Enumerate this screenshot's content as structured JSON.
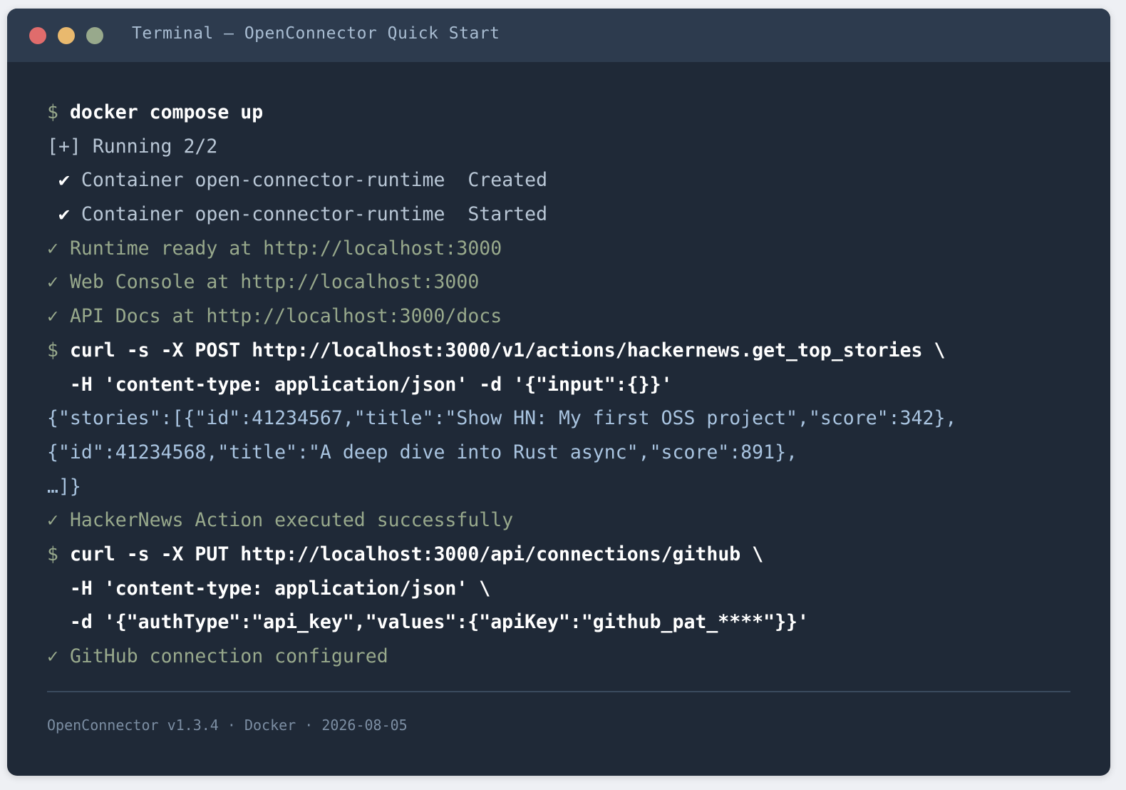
{
  "window": {
    "title": "Terminal — OpenConnector Quick Start",
    "controls": [
      "close",
      "minimize",
      "maximize"
    ]
  },
  "terminal": {
    "prompt_symbol": "$",
    "check_symbol": "✓",
    "check_bold_symbol": "✔",
    "lines": {
      "l1_cmd": "docker compose up",
      "l2_out": "[+] Running 2/2",
      "l3_out": "Container open-connector-runtime  Created",
      "l4_out": "Container open-connector-runtime  Started",
      "l5_ok": "Runtime ready at http://localhost:3000",
      "l6_ok": "Web Console at http://localhost:3000",
      "l7_ok": "API Docs at http://localhost:3000/docs",
      "l8_cmd": "curl -s -X POST http://localhost:3000/v1/actions/hackernews.get_top_stories \\",
      "l9_cmd": "  -H 'content-type: application/json' -d '{\"input\":{}}'",
      "l10_json": "{\"stories\":[{\"id\":41234567,\"title\":\"Show HN: My first OSS project\",\"score\":342},",
      "l11_json": "{\"id\":41234568,\"title\":\"A deep dive into Rust async\",\"score\":891},",
      "l12_json": "…]}",
      "l13_ok": "HackerNews Action executed successfully",
      "l14_cmd": "curl -s -X PUT http://localhost:3000/api/connections/github \\",
      "l15_cmd": "  -H 'content-type: application/json' \\",
      "l16_cmd": "  -d '{\"authType\":\"api_key\",\"values\":{\"apiKey\":\"github_pat_****\"}}'",
      "l17_ok": "GitHub connection configured"
    }
  },
  "footer": {
    "text": "OpenConnector v1.3.4 · Docker · 2026-08-05"
  },
  "colors": {
    "window_bg": "#1f2937",
    "titlebar_bg": "#2d3b4e",
    "close": "#e06c6c",
    "minimize": "#e9b96e",
    "maximize": "#98a98c",
    "success_text": "#98a98c",
    "command_text": "#ffffff"
  }
}
